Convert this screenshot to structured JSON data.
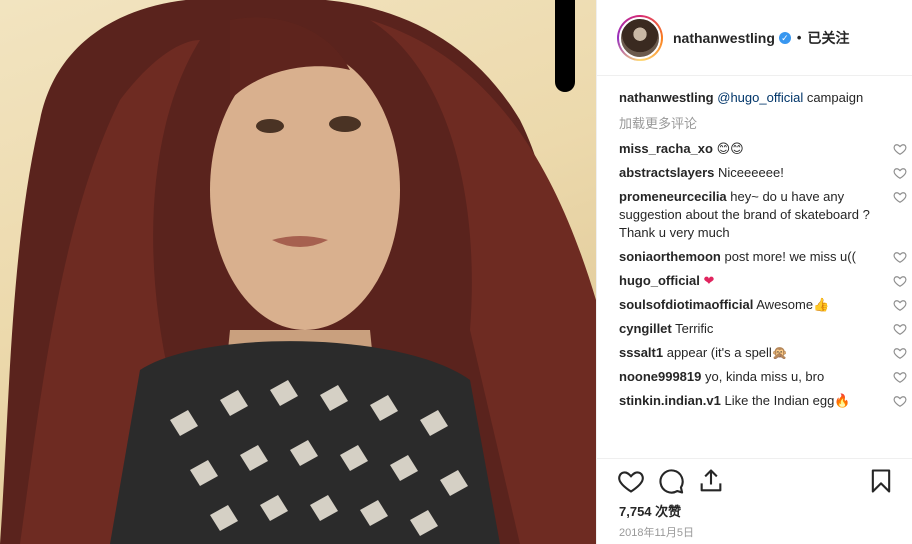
{
  "post": {
    "username": "nathanwestling",
    "follow_state": "已关注",
    "caption": {
      "username": "nathanwestling",
      "mention": "@hugo_official",
      "text": " campaign"
    },
    "load_more": "加载更多评论",
    "comments": [
      {
        "user": "miss_racha_xo",
        "text": "",
        "emoji": "😊😊"
      },
      {
        "user": "abstractslayers",
        "text": "Niceeeeee!",
        "emoji": ""
      },
      {
        "user": "promeneurcecilia",
        "text": "hey~ do u have any suggestion about the brand of skateboard ? Thank u very much",
        "emoji": ""
      },
      {
        "user": "soniaorthemoon",
        "text": "post more! we miss u((",
        "emoji": ""
      },
      {
        "user": "hugo_official",
        "text": "",
        "emoji": "❤"
      },
      {
        "user": "soulsofdiotimaofficial",
        "text": "Awesome",
        "emoji": "👍"
      },
      {
        "user": "cyngillet",
        "text": "Terrific",
        "emoji": ""
      },
      {
        "user": "sssalt1",
        "text": "appear (it's a spell",
        "emoji": "🙊"
      },
      {
        "user": "noone999819",
        "text": "yo, kinda miss u, bro",
        "emoji": ""
      },
      {
        "user": "stinkin.indian.v1",
        "text": "Like the Indian egg",
        "emoji": "🔥"
      }
    ],
    "likes": "7,754 次赞",
    "date": "2018年11月5日"
  },
  "icons": {
    "verified": "verified-badge-icon",
    "like": "heart-icon",
    "comment": "comment-bubble-icon",
    "share": "share-icon",
    "save": "bookmark-icon"
  },
  "colors": {
    "verified": "#3897f0",
    "text": "#262626",
    "muted": "#999999",
    "border": "#efefef"
  }
}
